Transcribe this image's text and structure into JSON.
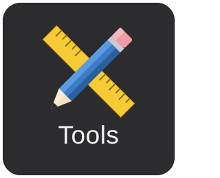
{
  "app": {
    "label": "Tools",
    "icon": "ruler-pencil-icon"
  },
  "colors": {
    "tile_background": "#2c2c2e",
    "label": "#f2f2f2",
    "ruler": "#f7cb35",
    "pencil_body": "#3a7cc6",
    "pencil_tip": "#f1e2c8",
    "eraser": "#f19aa6"
  }
}
